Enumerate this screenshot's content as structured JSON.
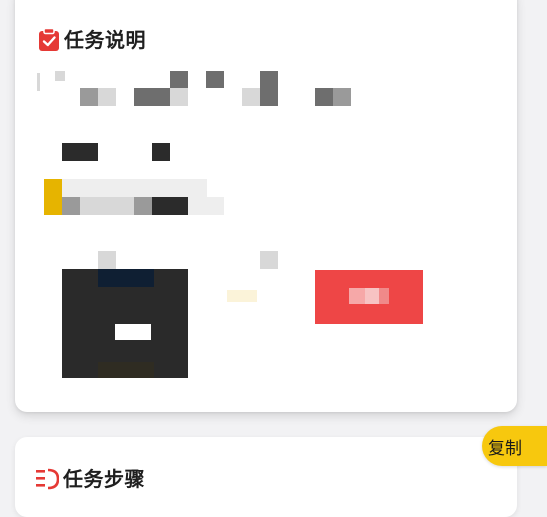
{
  "task_card": {
    "title": "任务说明",
    "title_icon": "clipboard-check-icon",
    "accent_color": "#e53935"
  },
  "steps_card": {
    "title": "任务步骤",
    "title_icon": "steps-list-icon"
  },
  "copy_button": {
    "label": "复制",
    "color": "#f7c80e"
  },
  "action_button": {
    "color": "#ee4646"
  }
}
